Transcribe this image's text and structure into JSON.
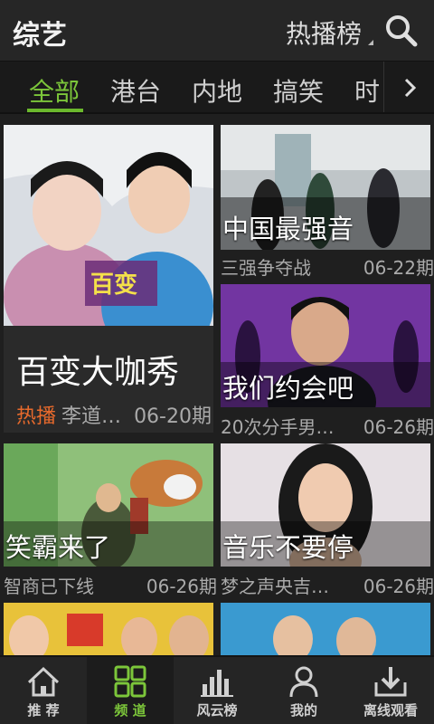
{
  "header": {
    "title": "综艺",
    "hot_rank_label": "热播榜"
  },
  "tabs": [
    "全部",
    "港台",
    "内地",
    "搞笑",
    "时"
  ],
  "cards": {
    "featured": {
      "title": "百变大咖秀",
      "badge": "热播",
      "subtitle": "李道…",
      "episode": "06-20期"
    },
    "c1": {
      "title": "中国最强音",
      "subtitle": "三强争夺战",
      "episode": "06-22期"
    },
    "c2": {
      "title": "我们约会吧",
      "subtitle": "20次分手男…",
      "episode": "06-26期"
    },
    "c3": {
      "title": "笑霸来了",
      "subtitle": "智商已下线",
      "episode": "06-26期"
    },
    "c4": {
      "title": "音乐不要停",
      "subtitle": "梦之声央吉…",
      "episode": "06-26期"
    }
  },
  "bottom_nav": [
    {
      "label": "推 荐",
      "icon": "home-icon"
    },
    {
      "label": "频 道",
      "icon": "grid-icon"
    },
    {
      "label": "风云榜",
      "icon": "chart-icon"
    },
    {
      "label": "我的",
      "icon": "user-icon"
    },
    {
      "label": "离线观看",
      "icon": "download-icon"
    }
  ],
  "colors": {
    "accent": "#7cc63a",
    "hot": "#e86a2c",
    "background": "#1f1f1f"
  }
}
